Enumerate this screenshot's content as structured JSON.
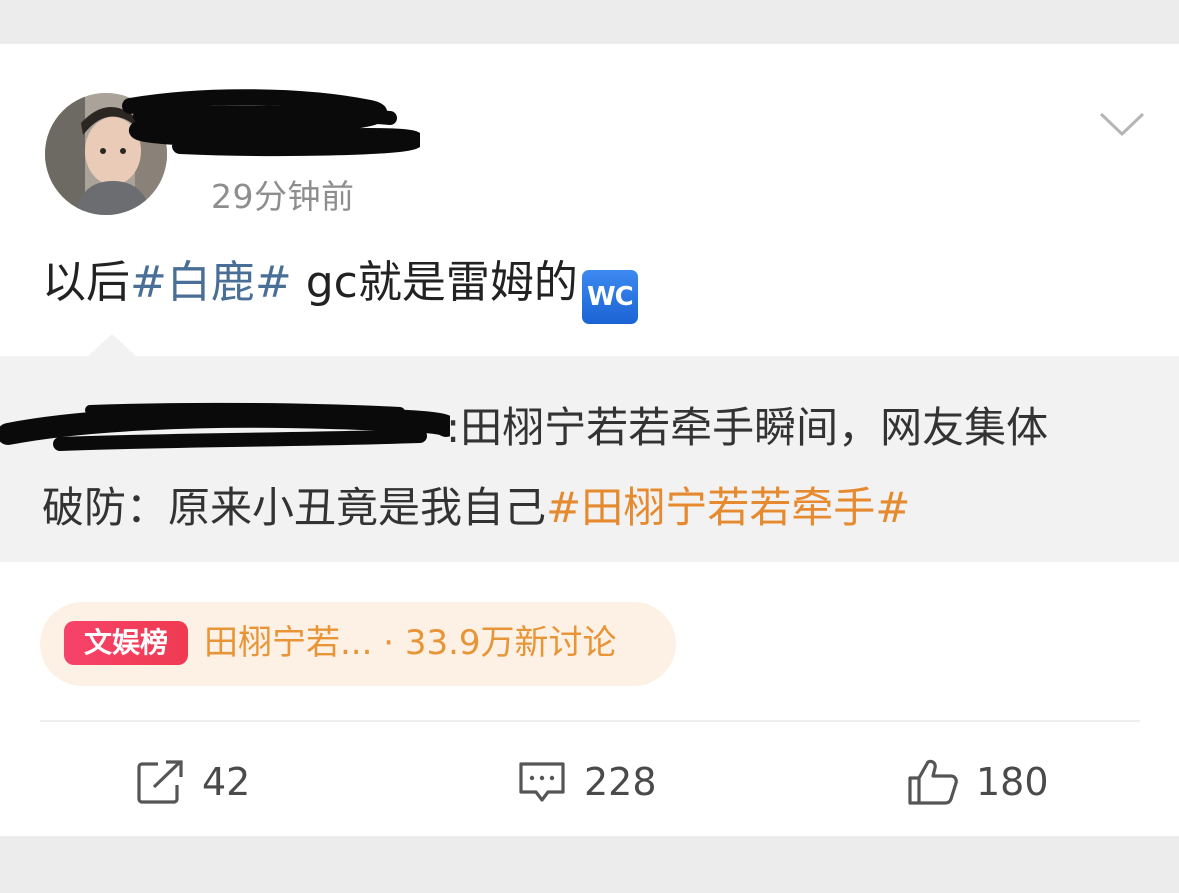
{
  "post": {
    "timestamp": "29分钟前",
    "text_before": "以后",
    "hashtag": "#白鹿#",
    "text_after": " gc就是雷姆的",
    "wc_emoji": "WC",
    "menu_icon": "chevron-down-icon"
  },
  "repost": {
    "line1": ":田栩宁若若牵手瞬间，网友集体",
    "line2_text": "破防：原来小丑竟是我自己",
    "line2_hashtag": "#田栩宁若若牵手#"
  },
  "trend": {
    "badge": "文娱榜",
    "text": "田栩宁若... · 33.9万新讨论"
  },
  "actions": {
    "repost_count": "42",
    "comment_count": "228",
    "like_count": "180"
  },
  "colors": {
    "hashtag_blue": "#4a6f97",
    "hashtag_orange": "#e58a2e",
    "badge_red": "#f7436a",
    "pill_bg": "#fdf1e5"
  }
}
